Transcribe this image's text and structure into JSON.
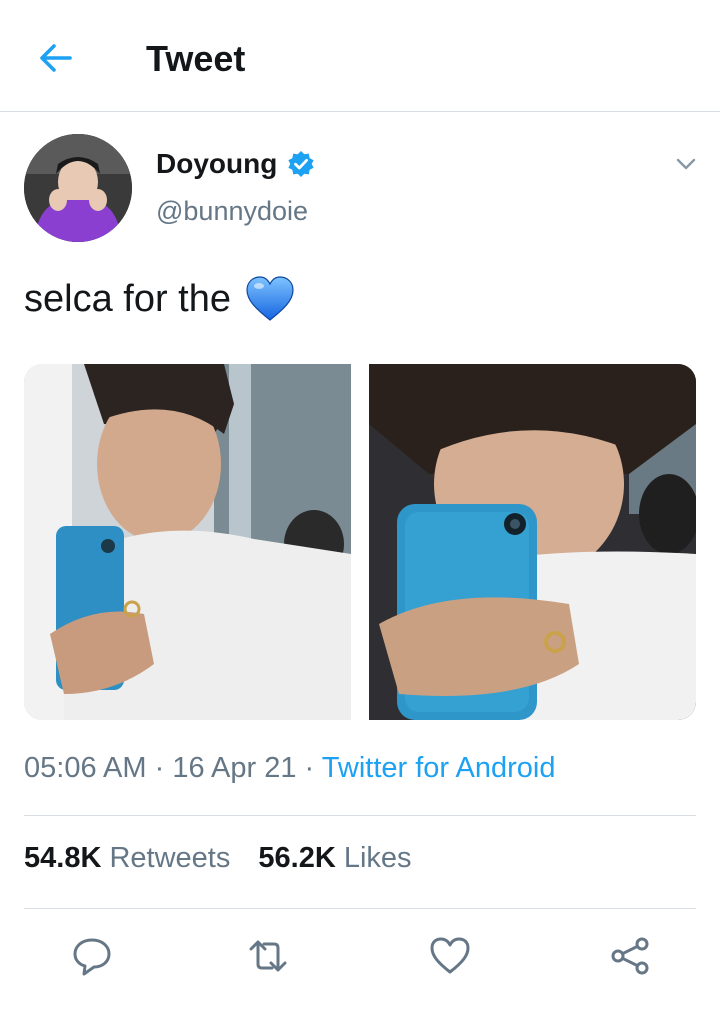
{
  "header": {
    "title": "Tweet",
    "back_icon": "arrow-left-icon"
  },
  "tweet": {
    "display_name": "Doyoung",
    "handle": "@bunnydoie",
    "text": "selca for the",
    "emoji": "blue-heart",
    "time": "05:06 AM",
    "date": "16 Apr 21",
    "separator": "·",
    "source": "Twitter for Android",
    "media_count": 2
  },
  "stats": {
    "retweets_count": "54.8K",
    "retweets_label": "Retweets",
    "likes_count": "56.2K",
    "likes_label": "Likes"
  },
  "actions": [
    "reply-icon",
    "retweet-icon",
    "like-icon",
    "share-icon"
  ],
  "colors": {
    "accent": "#1da1f2",
    "text": "#14171a",
    "muted": "#657786",
    "divider": "#d8dee3"
  }
}
